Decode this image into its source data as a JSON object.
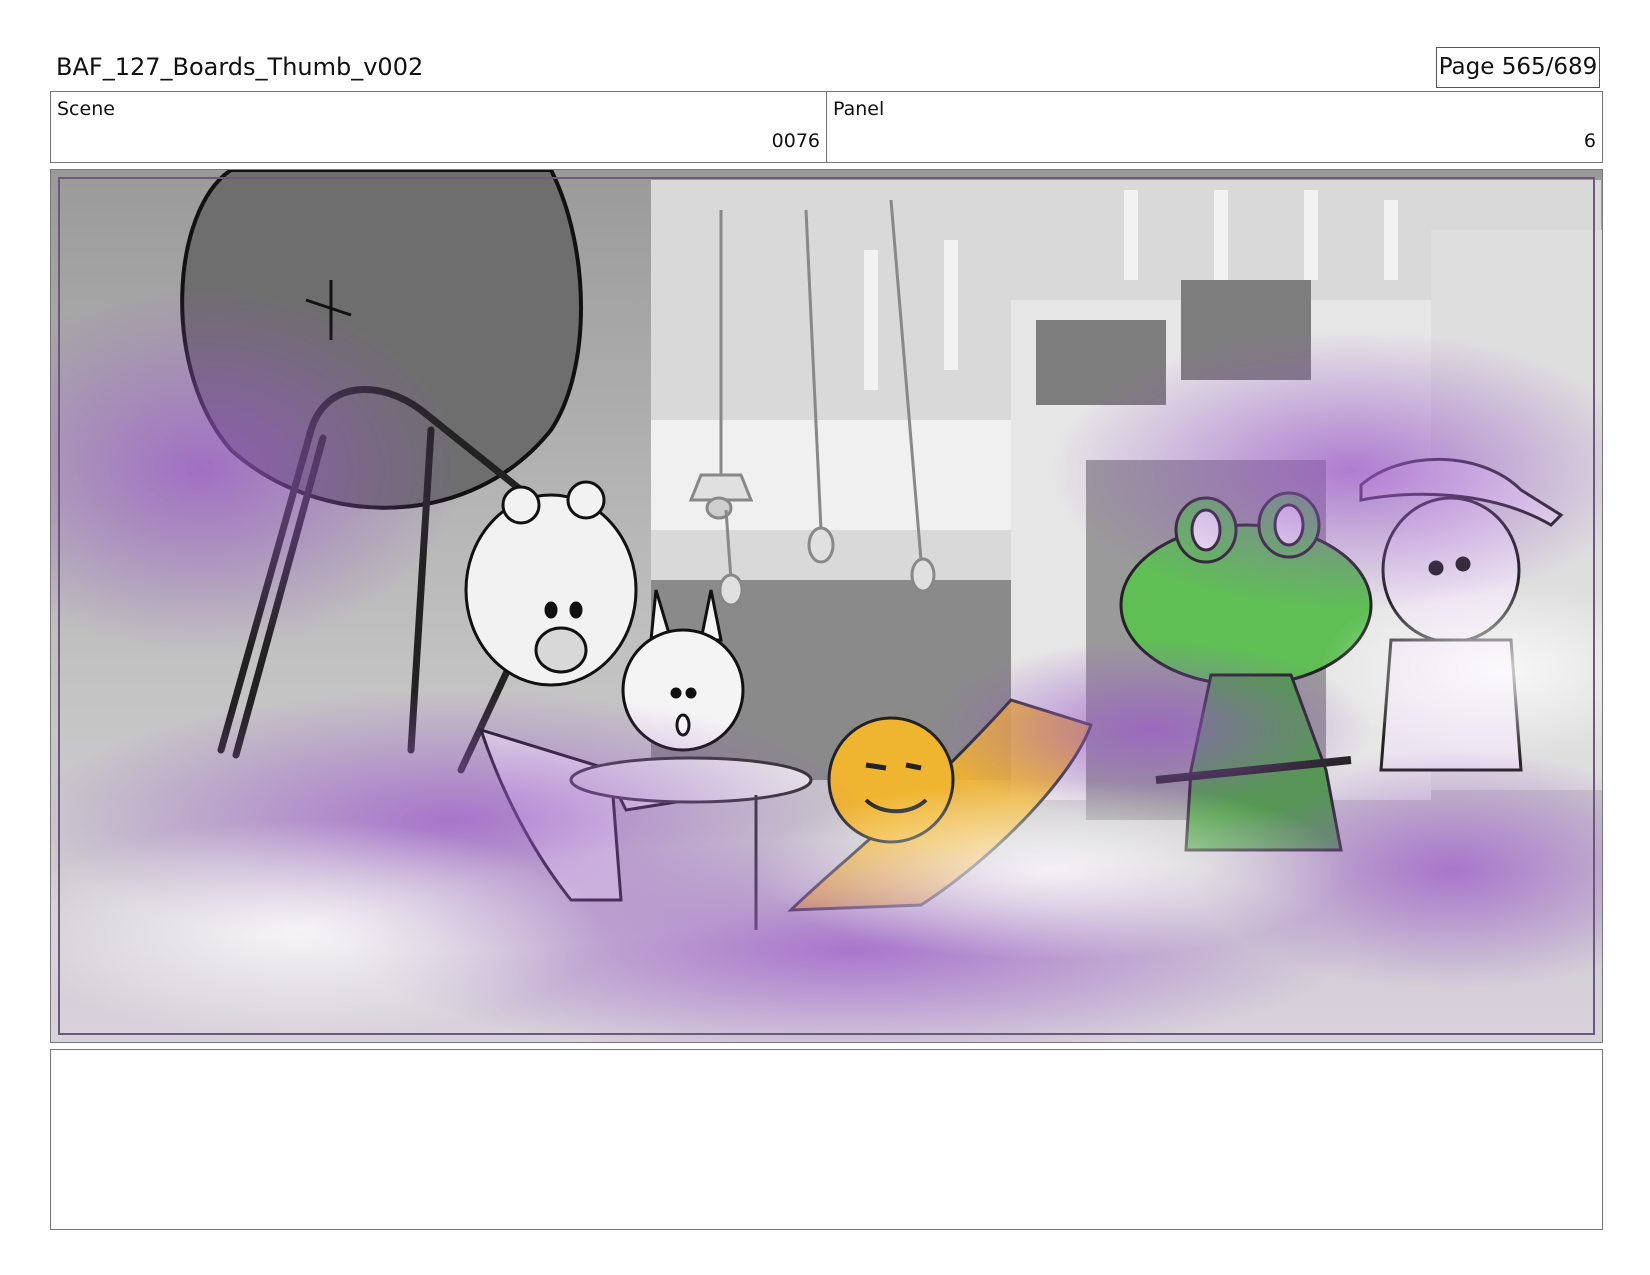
{
  "header": {
    "title": "BAF_127_Boards_Thumb_v002",
    "page": "Page 565/689"
  },
  "scene": {
    "label": "Scene",
    "value": "0076"
  },
  "panel": {
    "label": "Panel",
    "value": "6"
  },
  "notes": {
    "text": ""
  },
  "colors": {
    "smoke": "#9b59c9",
    "frog": "#5fbf55",
    "chick": "#f0b530",
    "background": "#b0b0b0"
  }
}
